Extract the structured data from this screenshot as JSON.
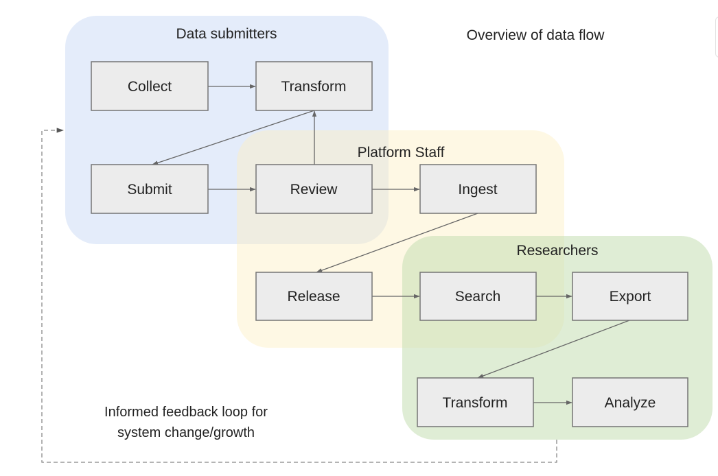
{
  "title": "Overview of data flow",
  "groups": [
    {
      "id": "submitters",
      "label": "Data submitters",
      "color": "#c9d9f5"
    },
    {
      "id": "staff",
      "label": "Platform Staff",
      "color": "#fdefc4"
    },
    {
      "id": "researchers",
      "label": "Researchers",
      "color": "#c5deb2"
    }
  ],
  "nodes": {
    "collect": "Collect",
    "transform_submitter": "Transform",
    "submit": "Submit",
    "review": "Review",
    "ingest": "Ingest",
    "release": "Release",
    "search": "Search",
    "export": "Export",
    "transform_researcher": "Transform",
    "analyze": "Analyze"
  },
  "edges": [
    {
      "from": "collect",
      "to": "transform_submitter"
    },
    {
      "from": "transform_submitter",
      "to": "submit"
    },
    {
      "from": "submit",
      "to": "review"
    },
    {
      "from": "review",
      "to": "transform_submitter"
    },
    {
      "from": "review",
      "to": "ingest"
    },
    {
      "from": "ingest",
      "to": "release"
    },
    {
      "from": "release",
      "to": "search"
    },
    {
      "from": "search",
      "to": "export"
    },
    {
      "from": "export",
      "to": "transform_researcher"
    },
    {
      "from": "transform_researcher",
      "to": "analyze"
    },
    {
      "from": "researchers",
      "to": "submitters",
      "style": "dashed"
    }
  ],
  "feedback_note": {
    "line1": "Informed feedback loop for",
    "line2": "system change/growth"
  },
  "colors": {
    "node_fill": "#ececec",
    "node_stroke": "#757575",
    "edge": "#666666"
  }
}
